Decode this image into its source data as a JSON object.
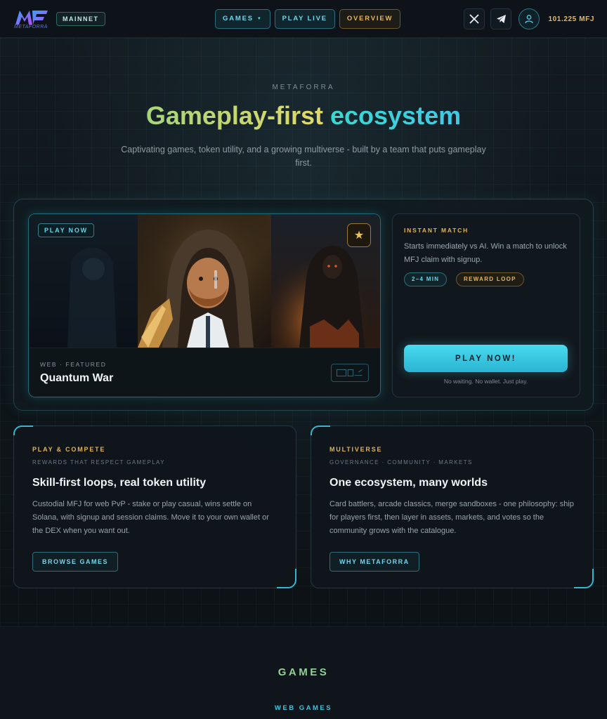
{
  "nav": {
    "logo_text": "METAFORRA",
    "network": "MAINNET",
    "games_label": "GAMES",
    "play_live_label": "PLAY LIVE",
    "overview_label": "OVERVIEW",
    "balance": "101.225 MFJ",
    "icons": [
      "x-icon",
      "telegram-icon",
      "user-icon"
    ]
  },
  "hero": {
    "eyebrow": "METAFORRA",
    "headline_part1": "Gameplay-first",
    "headline_part2": "ecosystem",
    "subtitle": "Captivating games, token utility, and a growing multiverse - built by a team that puts gameplay first."
  },
  "featured": {
    "tag": "PLAY NOW",
    "meta": "WEB · FEATURED",
    "title": "Quantum War"
  },
  "instant_match": {
    "kicker": "INSTANT MATCH",
    "description": "Starts immediately vs AI. Win a match to unlock MFJ claim with signup.",
    "pills": [
      "2–4 MIN",
      "REWARD LOOP"
    ],
    "cta": "PLAY NOW!",
    "note": "No waiting. No wallet. Just play."
  },
  "cards": [
    {
      "kicker": "PLAY & COMPETE",
      "sub": "REWARDS THAT RESPECT GAMEPLAY",
      "title": "Skill-first loops, real token utility",
      "body": "Custodial MFJ for web PvP - stake or play casual, wins settle on Solana, with signup and session claims. Move it to your own wallet or the DEX when you want out.",
      "button": "BROWSE GAMES"
    },
    {
      "kicker": "MULTIVERSE",
      "sub": "GOVERNANCE · COMMUNITY · MARKETS",
      "title": "One ecosystem, many worlds",
      "body": "Card battlers, arcade classics, merge sandboxes - one philosophy: ship for players first, then layer in assets, markets, and votes so the community grows with the catalogue.",
      "button": "WHY METAFORRA"
    }
  ],
  "games_section": {
    "title": "GAMES",
    "subtitle": "WEB GAMES"
  },
  "colors": {
    "accent_teal": "#3fc3df",
    "accent_gold": "#e0b451",
    "background": "#0c1116"
  }
}
